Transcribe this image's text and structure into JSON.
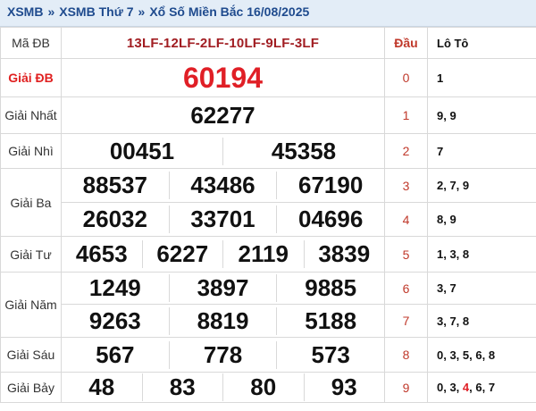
{
  "header": {
    "crumbs": [
      "XSMB",
      "XSMB Thứ 7",
      "Xổ Số Miền Bắc 16/08/2025"
    ],
    "separator": "»"
  },
  "results": {
    "ma_db_label": "Mã ĐB",
    "ma_db_value": "13LF-12LF-2LF-10LF-9LF-3LF",
    "prizes": [
      {
        "label": "Giải ĐB",
        "rows": [
          [
            "60194"
          ]
        ]
      },
      {
        "label": "Giải Nhất",
        "rows": [
          [
            "62277"
          ]
        ]
      },
      {
        "label": "Giải Nhì",
        "rows": [
          [
            "00451",
            "45358"
          ]
        ]
      },
      {
        "label": "Giải Ba",
        "rows": [
          [
            "88537",
            "43486",
            "67190"
          ],
          [
            "26032",
            "33701",
            "04696"
          ]
        ]
      },
      {
        "label": "Giải Tư",
        "rows": [
          [
            "4653",
            "6227",
            "2119",
            "3839"
          ]
        ]
      },
      {
        "label": "Giải Năm",
        "rows": [
          [
            "1249",
            "3897",
            "9885"
          ],
          [
            "9263",
            "8819",
            "5188"
          ]
        ]
      },
      {
        "label": "Giải Sáu",
        "rows": [
          [
            "567",
            "778",
            "573"
          ]
        ]
      },
      {
        "label": "Giải Bảy",
        "rows": [
          [
            "48",
            "83",
            "80",
            "93"
          ]
        ]
      }
    ]
  },
  "loto": {
    "dau_header": "Đầu",
    "loto_header": "Lô Tô",
    "rows": [
      {
        "dau": "0",
        "values": "1"
      },
      {
        "dau": "1",
        "values": "9, 9"
      },
      {
        "dau": "2",
        "values": "7"
      },
      {
        "dau": "3",
        "values": "2, 7, 9"
      },
      {
        "dau": "4",
        "values": "8, 9"
      },
      {
        "dau": "5",
        "values": "1, 3, 8"
      },
      {
        "dau": "6",
        "values": "3, 7"
      },
      {
        "dau": "7",
        "values": "3, 7, 8"
      },
      {
        "dau": "8",
        "values": "0, 3, 5, 6, 8"
      },
      {
        "dau": "9",
        "values_pre": "0, 3, ",
        "values_red": "4",
        "values_post": ", 6, 7"
      }
    ]
  },
  "colors": {
    "accent_red": "#e01f26",
    "header_blue": "#1f4b8e",
    "code_red": "#a11d22"
  }
}
